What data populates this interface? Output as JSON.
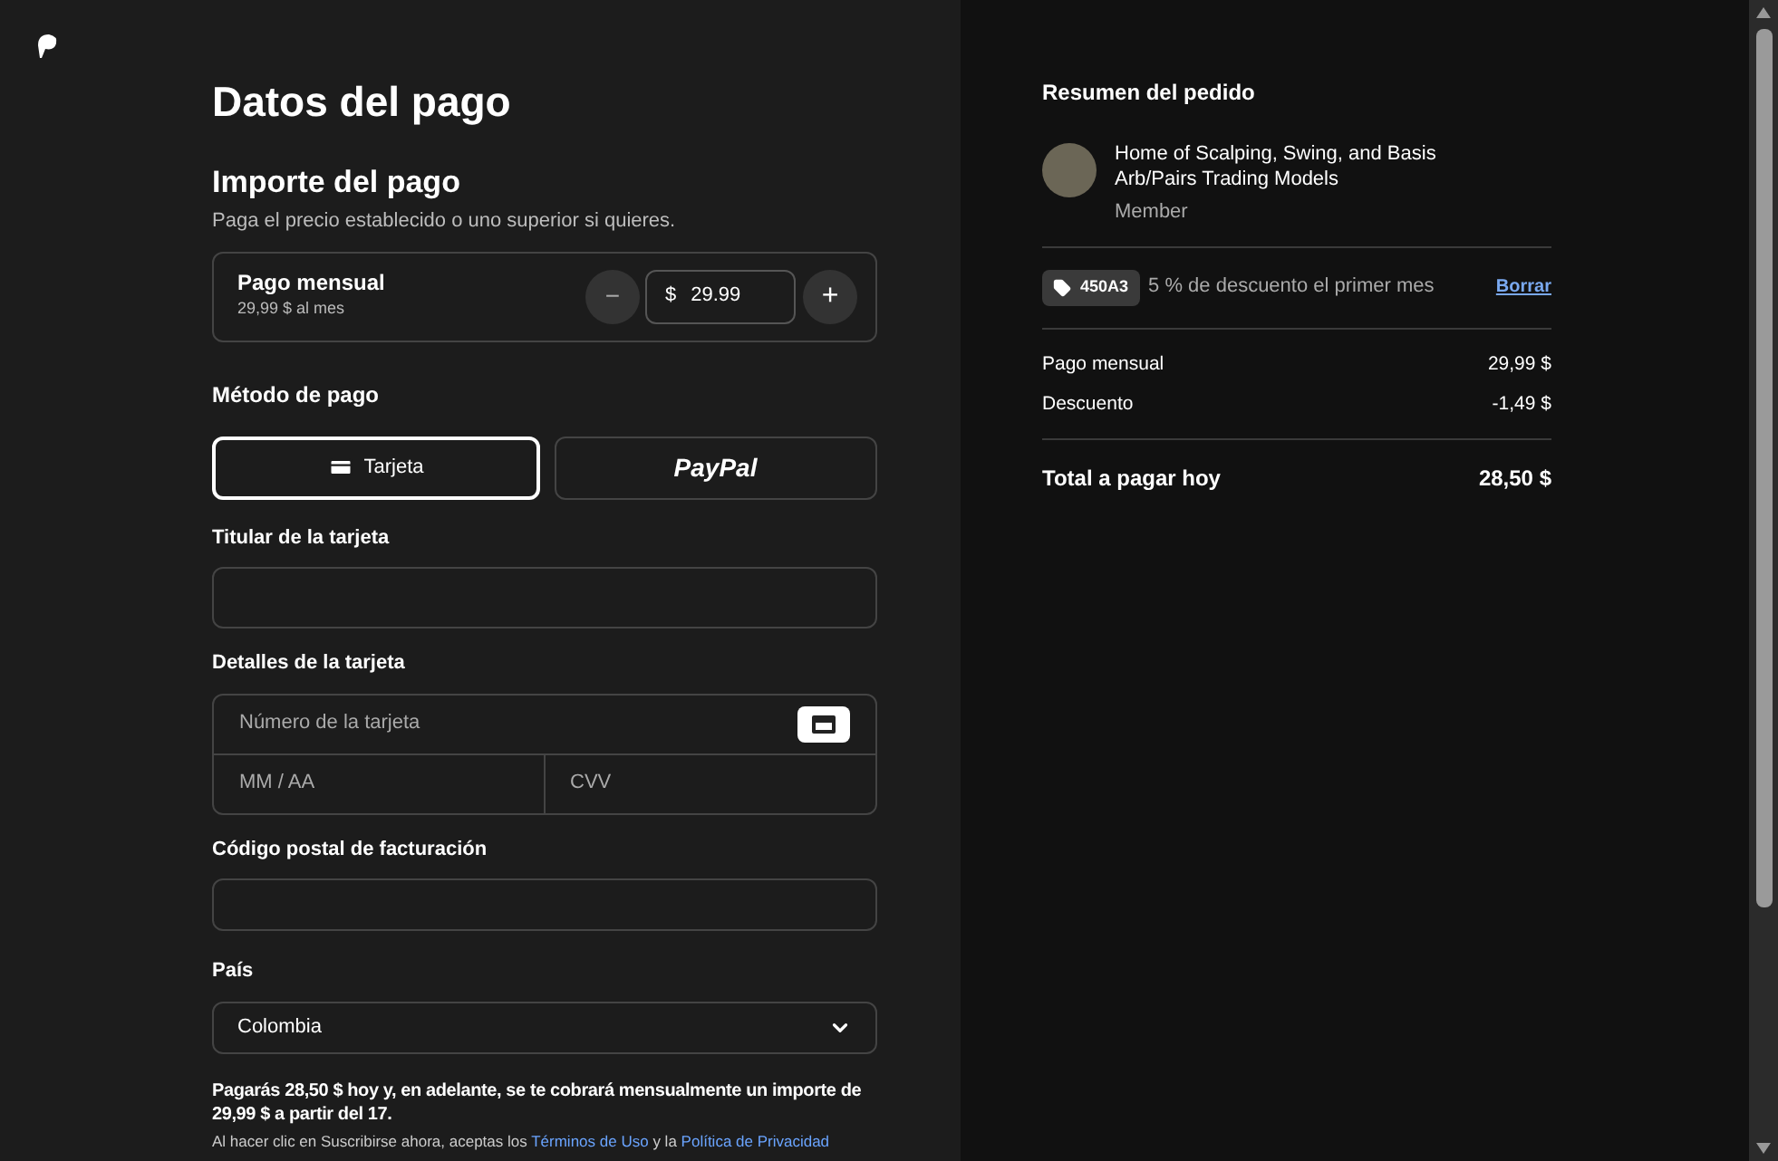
{
  "title": "Datos del pago",
  "amount": {
    "heading": "Importe del pago",
    "note": "Paga el precio establecido o uno superior si quieres.",
    "plan": "Pago mensual",
    "plan_price": "29,99 $ al mes",
    "currency": "$",
    "value": "29.99",
    "decrease": "−",
    "increase": "+"
  },
  "method": {
    "heading": "Método de pago",
    "options": [
      {
        "kind": "card",
        "label": "Tarjeta",
        "selected": true
      },
      {
        "kind": "paypal",
        "label": "PayPal",
        "selected": false
      }
    ]
  },
  "card_holder": {
    "label": "Titular de la tarjeta"
  },
  "card_details": {
    "label": "Detalles de la tarjeta",
    "number_placeholder": "Número de la tarjeta",
    "expiry_placeholder": "MM / AA",
    "cvv_placeholder": "CVV"
  },
  "postal": {
    "label": "Código postal de facturación"
  },
  "country": {
    "label": "País",
    "value": "Colombia"
  },
  "notice": "Pagarás 28,50 $ hoy y, en adelante, se te cobrará mensualmente un importe de 29,99 $ a partir del 17.",
  "legal": {
    "text": "Al hacer clic en Suscribirse ahora, aceptas los",
    "terms": "Términos de Uso",
    "and": "y la",
    "privacy": "Política de Privacidad"
  },
  "summary": {
    "heading": "Resumen del pedido",
    "product": "Home of Scalping, Swing, and Basis Arb/Pairs Trading Models",
    "tier": "Member",
    "coupon": "450A3",
    "coupon_note": "5 % de descuento el primer mes",
    "remove": "Borrar",
    "lines": [
      {
        "label": "Pago mensual",
        "amount": "29,99 $"
      },
      {
        "label": "Descuento",
        "amount": "-1,49 $"
      }
    ],
    "total_label": "Total a pagar hoy",
    "total": "28,50 $"
  }
}
